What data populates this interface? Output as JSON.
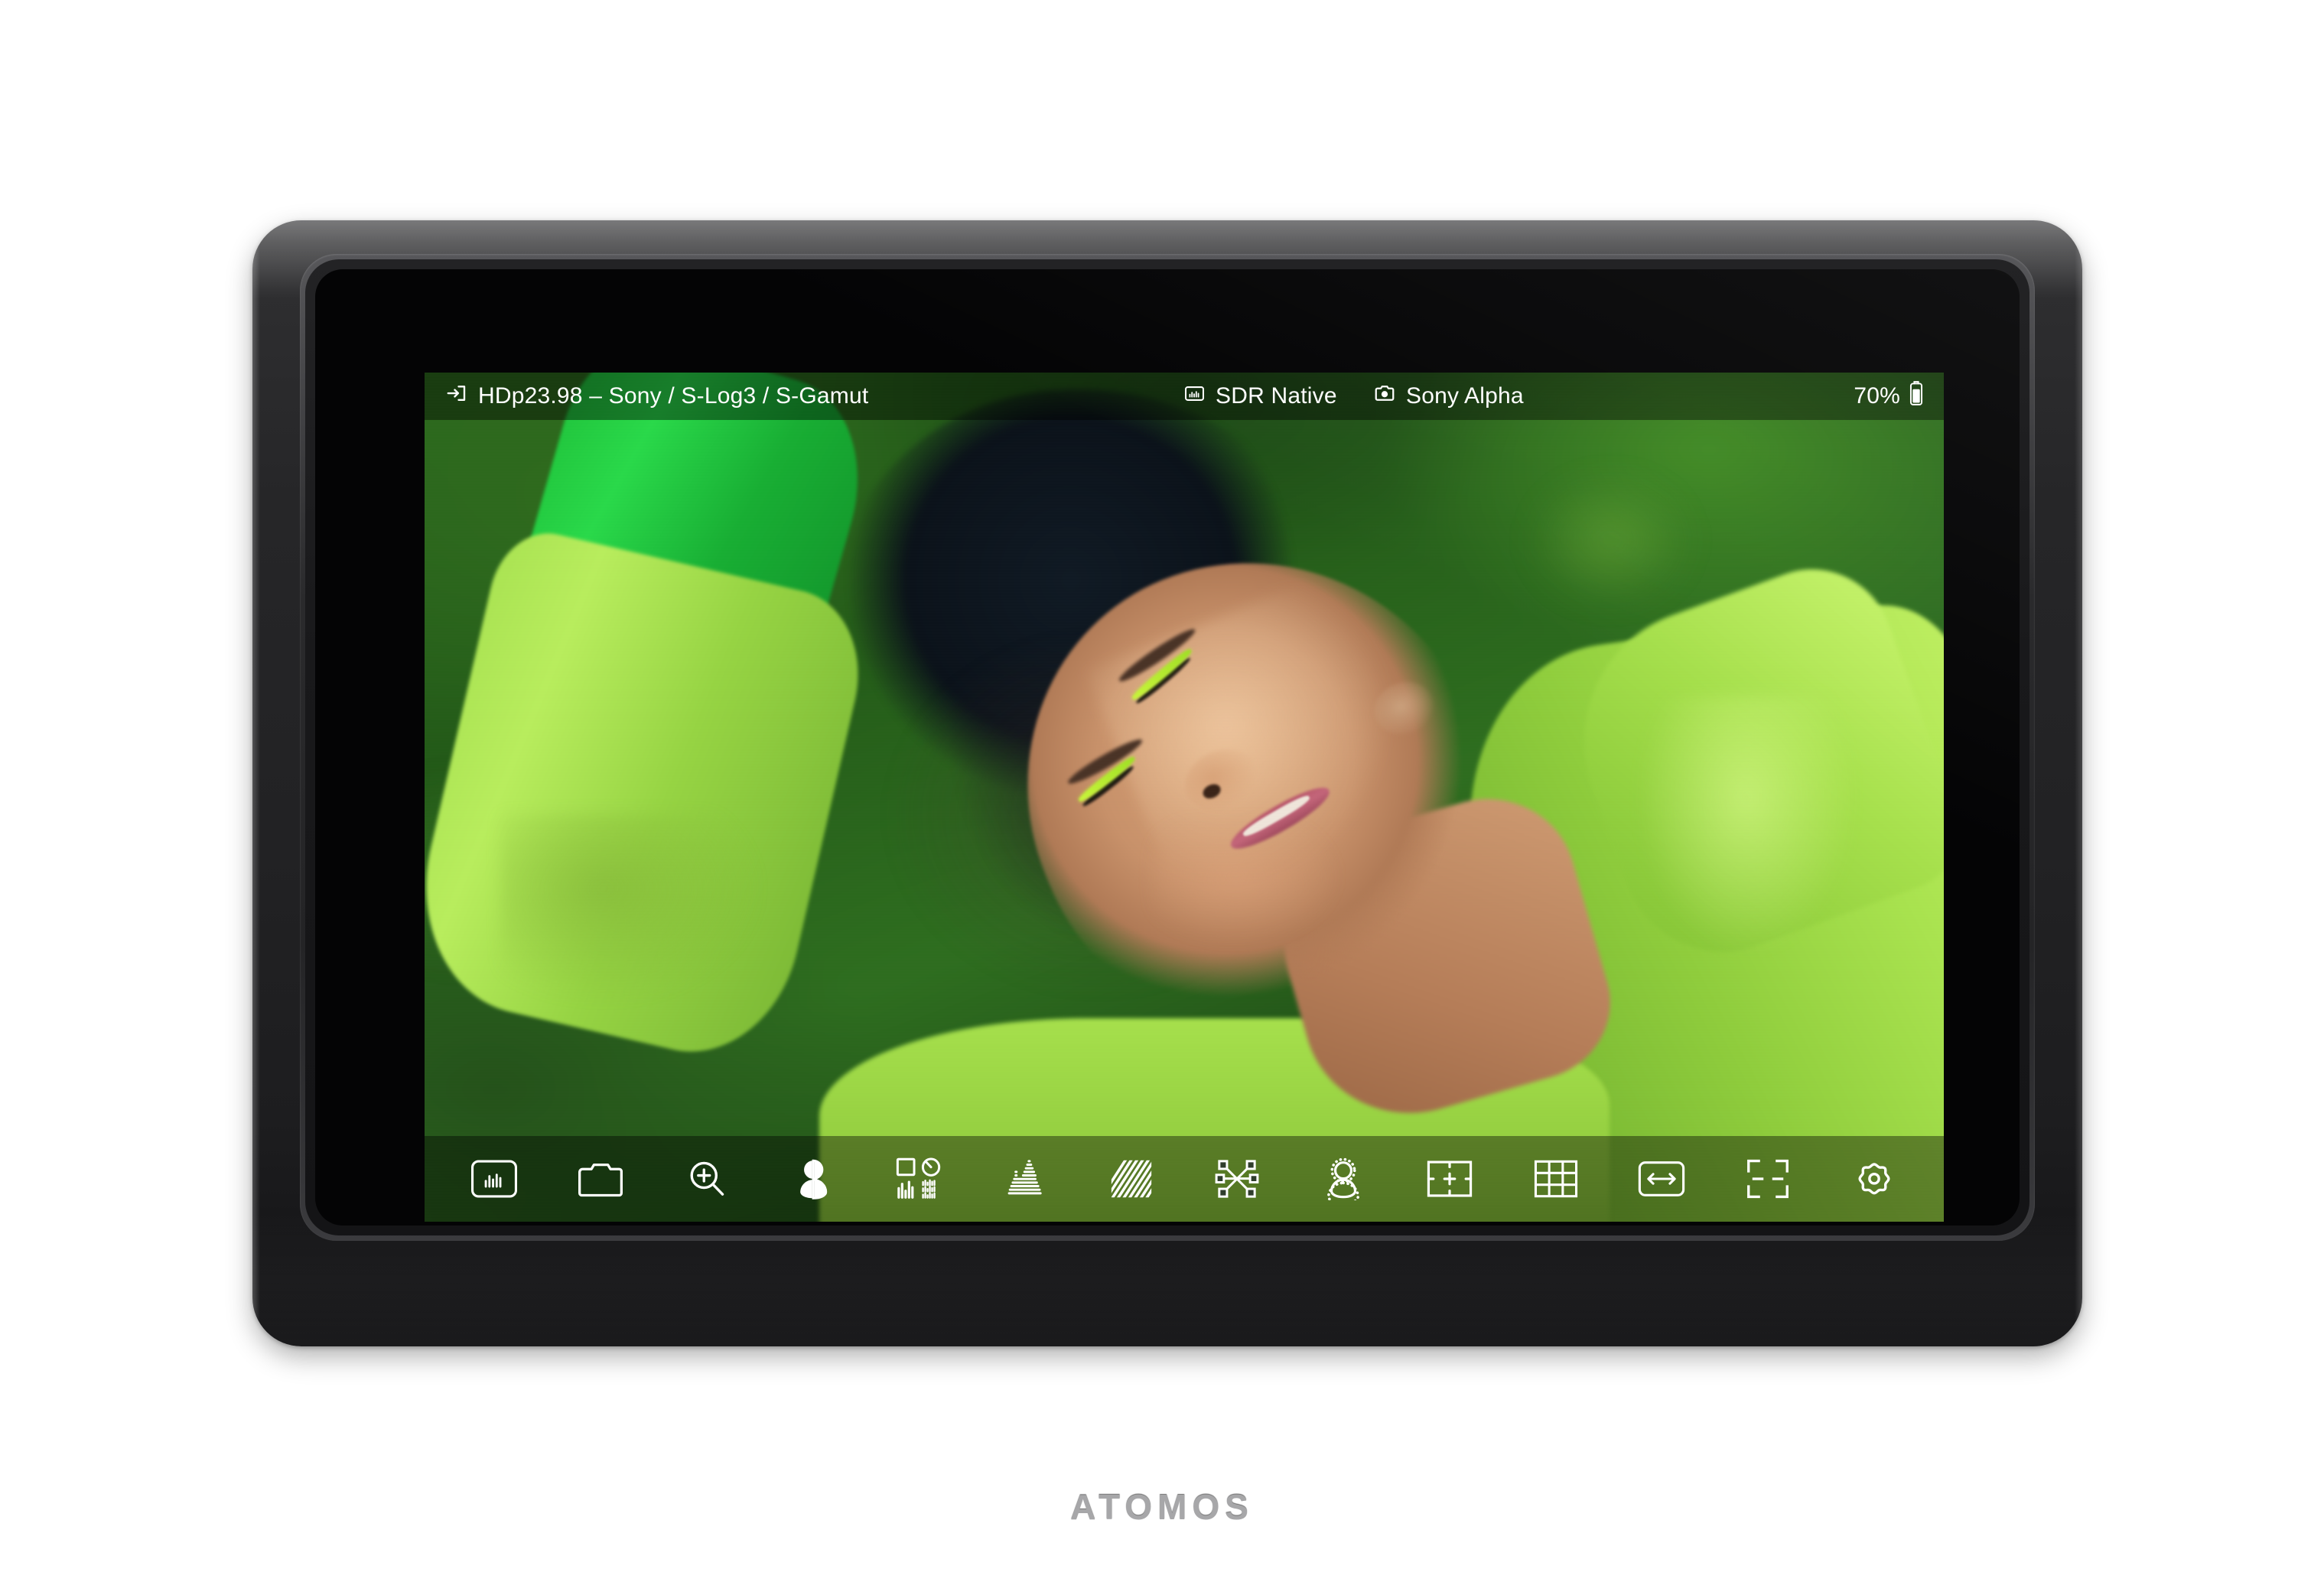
{
  "device": {
    "brand_label": "ATOMOS"
  },
  "osd": {
    "header": {
      "input": {
        "icon": "input-signal-icon",
        "label": "HDp23.98 – Sony / S-Log3 / S-Gamut"
      },
      "lut": {
        "icon": "histogram-box-icon",
        "label": "SDR Native"
      },
      "camera": {
        "icon": "camera-icon",
        "label": "Sony Alpha"
      },
      "battery": {
        "icon": "battery-icon",
        "label": "70%"
      }
    },
    "toolbar": {
      "items": [
        {
          "icon": "histogram-box-icon",
          "label": "Monitor Info"
        },
        {
          "icon": "camera-icon",
          "label": "Camera Control"
        },
        {
          "icon": "zoom-in-icon",
          "label": "Punch In Zoom"
        },
        {
          "icon": "exposure-person-icon",
          "label": "Exposure"
        },
        {
          "icon": "scopes-grid-icon",
          "label": "Scopes"
        },
        {
          "icon": "waveform-icon",
          "label": "Waveform"
        },
        {
          "icon": "zebra-stripes-icon",
          "label": "Zebra"
        },
        {
          "icon": "anamorphic-desqueeze-icon",
          "label": "Anamorphic"
        },
        {
          "icon": "focus-peaking-icon",
          "label": "Focus Peaking"
        },
        {
          "icon": "frame-guide-icon",
          "label": "Frame Guides"
        },
        {
          "icon": "grid-3x3-icon",
          "label": "Grid"
        },
        {
          "icon": "aspect-ratio-icon",
          "label": "Aspect Ratio"
        },
        {
          "icon": "safe-area-icon",
          "label": "Safe Area"
        },
        {
          "icon": "gear-icon",
          "label": "Settings"
        }
      ]
    }
  },
  "colors": {
    "osd_text": "#ffffff",
    "osd_overlay": "rgba(0,0,0,0.42)",
    "brand_text": "#a7a7a9",
    "bezel": "#242426"
  }
}
